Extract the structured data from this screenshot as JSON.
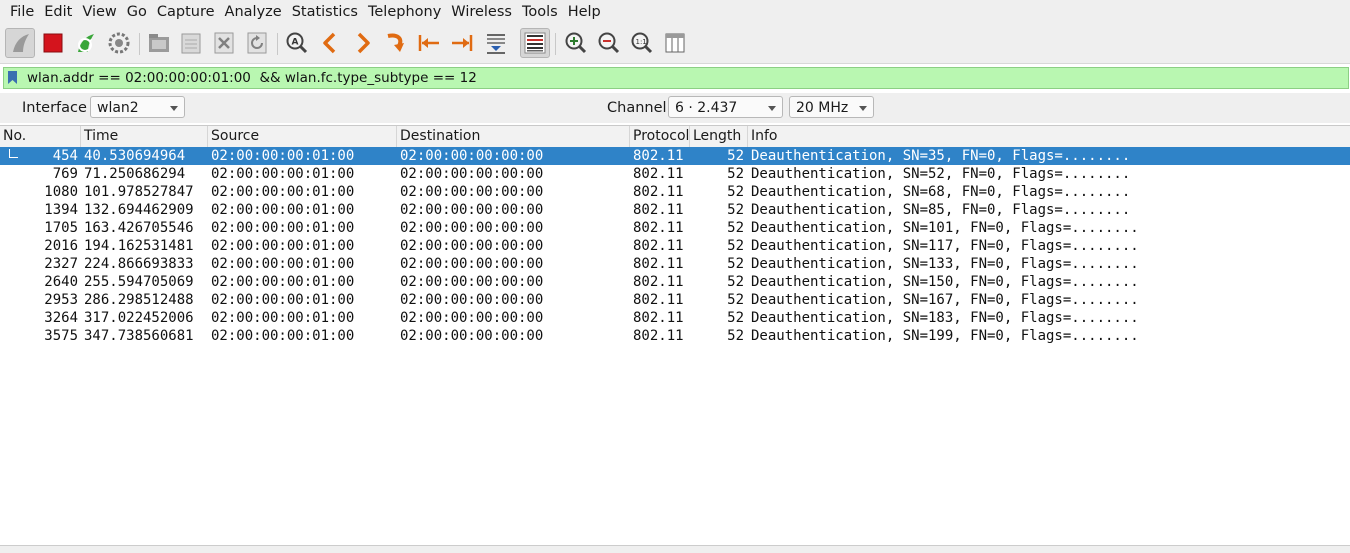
{
  "menubar": {
    "items": [
      "File",
      "Edit",
      "View",
      "Go",
      "Capture",
      "Analyze",
      "Statistics",
      "Telephony",
      "Wireless",
      "Tools",
      "Help"
    ]
  },
  "toolbar": {
    "buttons": [
      "start-capture-icon",
      "stop-capture-icon",
      "restart-capture-icon",
      "capture-options-icon",
      "open-file-icon",
      "save-file-icon",
      "close-file-icon",
      "reload-file-icon",
      "find-packet-icon",
      "go-back-icon",
      "go-forward-icon",
      "go-to-packet-icon",
      "first-packet-icon",
      "last-packet-icon",
      "auto-scroll-icon",
      "colorize-icon",
      "zoom-in-icon",
      "zoom-out-icon",
      "normal-size-icon",
      "resize-columns-icon"
    ]
  },
  "filter": {
    "text": "wlan.addr == 02:00:00:00:01:00  && wlan.fc.type_subtype == 12",
    "bg_color": "#b9f7b1"
  },
  "interface_bar": {
    "interface_label": "Interface",
    "interface_value": "wlan2",
    "channel_label": "Channel",
    "channel_value": "6 · 2.437",
    "width_value": "20 MHz"
  },
  "packet_list": {
    "columns": [
      "No.",
      "Time",
      "Source",
      "Destination",
      "Protocol",
      "Length",
      "Info"
    ],
    "rows": [
      {
        "no": "454",
        "time": "40.530694964",
        "source": "02:00:00:00:01:00",
        "destination": "02:00:00:00:00:00",
        "protocol": "802.11",
        "length": "52",
        "info": "Deauthentication, SN=35, FN=0, Flags=........"
      },
      {
        "no": "769",
        "time": "71.250686294",
        "source": "02:00:00:00:01:00",
        "destination": "02:00:00:00:00:00",
        "protocol": "802.11",
        "length": "52",
        "info": "Deauthentication, SN=52, FN=0, Flags=........"
      },
      {
        "no": "1080",
        "time": "101.978527847",
        "source": "02:00:00:00:01:00",
        "destination": "02:00:00:00:00:00",
        "protocol": "802.11",
        "length": "52",
        "info": "Deauthentication, SN=68, FN=0, Flags=........"
      },
      {
        "no": "1394",
        "time": "132.694462909",
        "source": "02:00:00:00:01:00",
        "destination": "02:00:00:00:00:00",
        "protocol": "802.11",
        "length": "52",
        "info": "Deauthentication, SN=85, FN=0, Flags=........"
      },
      {
        "no": "1705",
        "time": "163.426705546",
        "source": "02:00:00:00:01:00",
        "destination": "02:00:00:00:00:00",
        "protocol": "802.11",
        "length": "52",
        "info": "Deauthentication, SN=101, FN=0, Flags=........"
      },
      {
        "no": "2016",
        "time": "194.162531481",
        "source": "02:00:00:00:01:00",
        "destination": "02:00:00:00:00:00",
        "protocol": "802.11",
        "length": "52",
        "info": "Deauthentication, SN=117, FN=0, Flags=........"
      },
      {
        "no": "2327",
        "time": "224.866693833",
        "source": "02:00:00:00:01:00",
        "destination": "02:00:00:00:00:00",
        "protocol": "802.11",
        "length": "52",
        "info": "Deauthentication, SN=133, FN=0, Flags=........"
      },
      {
        "no": "2640",
        "time": "255.594705069",
        "source": "02:00:00:00:01:00",
        "destination": "02:00:00:00:00:00",
        "protocol": "802.11",
        "length": "52",
        "info": "Deauthentication, SN=150, FN=0, Flags=........"
      },
      {
        "no": "2953",
        "time": "286.298512488",
        "source": "02:00:00:00:01:00",
        "destination": "02:00:00:00:00:00",
        "protocol": "802.11",
        "length": "52",
        "info": "Deauthentication, SN=167, FN=0, Flags=........"
      },
      {
        "no": "3264",
        "time": "317.022452006",
        "source": "02:00:00:00:01:00",
        "destination": "02:00:00:00:00:00",
        "protocol": "802.11",
        "length": "52",
        "info": "Deauthentication, SN=183, FN=0, Flags=........"
      },
      {
        "no": "3575",
        "time": "347.738560681",
        "source": "02:00:00:00:01:00",
        "destination": "02:00:00:00:00:00",
        "protocol": "802.11",
        "length": "52",
        "info": "Deauthentication, SN=199, FN=0, Flags=........"
      }
    ],
    "selected_color": "#2f83c8"
  }
}
